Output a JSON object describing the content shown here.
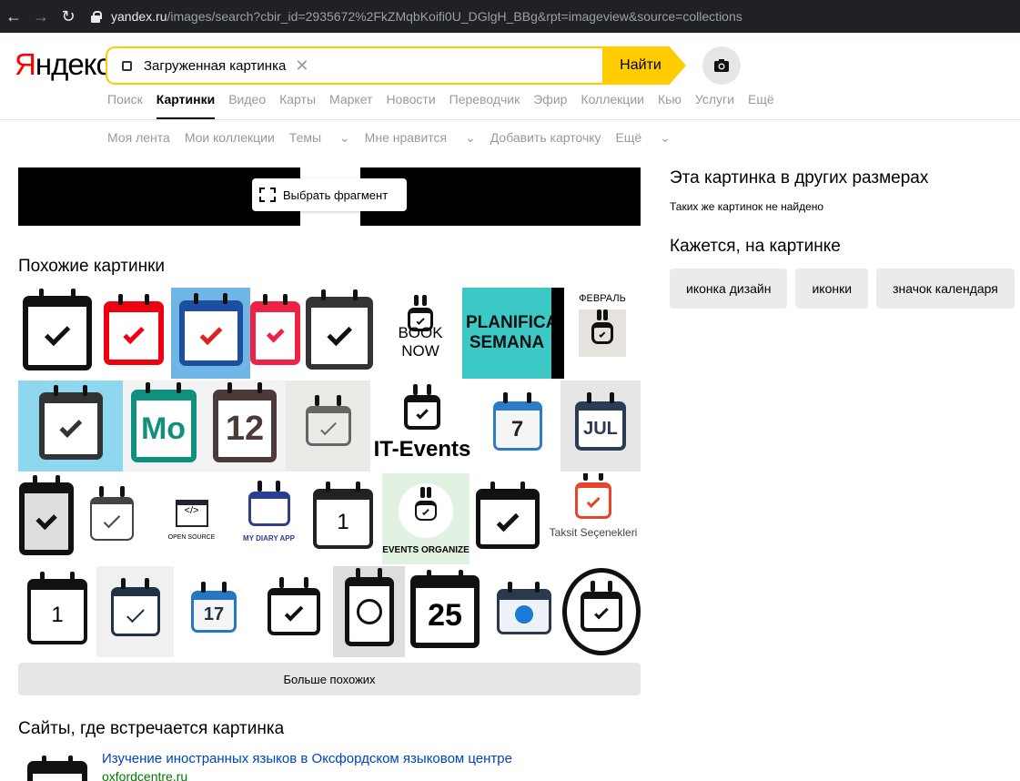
{
  "browser": {
    "url_host": "yandex.ru",
    "url_path": "/images/search?cbir_id=2935672%2FkZMqbKoifi0U_DGlgH_BBg&rpt=imageview&source=collections"
  },
  "header": {
    "logo_first": "Я",
    "logo_rest": "ндекс",
    "search_chip": "Загруженная картинка",
    "search_button": "Найти"
  },
  "services": [
    "Поиск",
    "Картинки",
    "Видео",
    "Карты",
    "Маркет",
    "Новости",
    "Переводчик",
    "Эфир",
    "Коллекции",
    "Кью",
    "Услуги",
    "Ещё"
  ],
  "subnav": [
    "Моя лента",
    "Мои коллекции",
    "Темы",
    "Мне нравится",
    "Добавить карточку",
    "Ещё"
  ],
  "preview": {
    "fragment_button": "Выбрать фрагмент"
  },
  "similar": {
    "title": "Похожие картинки",
    "tiles": {
      "book_now": "BOOK NOW",
      "planificador": "PLANIFICAD SEMANA",
      "febral": "ФЕВРАЛЬ",
      "mo": "Mo",
      "twelve": "12",
      "it_events": "IT-Events",
      "seven": "7",
      "jul": "JUL",
      "open_source": "OPEN SOURCE",
      "my_diary": "MY DIARY APP",
      "one": "1",
      "events_org": "EVENTS ORGANIZE",
      "taksit": "Taksit Seçenekleri",
      "seventeen": "17",
      "twentyfive": "25"
    },
    "more_button": "Больше похожих"
  },
  "sites": {
    "title": "Сайты, где встречается картинка",
    "link": "Изучение иностранных языков в Оксфордском языковом центре",
    "host": "oxfordcentre.ru"
  },
  "right": {
    "sizes_title": "Эта картинка в других размерах",
    "sizes_sub": "Таких же картинок не найдено",
    "tags_title": "Кажется, на картинке",
    "tags": [
      "иконка дизайн",
      "иконки",
      "значок календаря"
    ]
  }
}
